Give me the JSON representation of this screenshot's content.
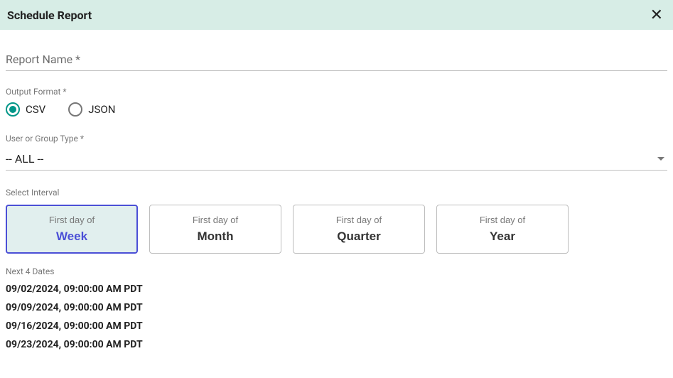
{
  "header": {
    "title": "Schedule Report"
  },
  "reportName": {
    "label": "Report Name *",
    "value": ""
  },
  "outputFormat": {
    "label": "Output Format *",
    "options": [
      {
        "label": "CSV",
        "selected": true
      },
      {
        "label": "JSON",
        "selected": false
      }
    ]
  },
  "userGroup": {
    "label": "User or Group Type *",
    "value": "-- ALL --"
  },
  "interval": {
    "label": "Select Interval",
    "cards": [
      {
        "top": "First day of",
        "bot": "Week",
        "selected": true
      },
      {
        "top": "First day of",
        "bot": "Month",
        "selected": false
      },
      {
        "top": "First day of",
        "bot": "Quarter",
        "selected": false
      },
      {
        "top": "First day of",
        "bot": "Year",
        "selected": false
      }
    ]
  },
  "nextDates": {
    "label": "Next 4 Dates",
    "items": [
      "09/02/2024, 09:00:00 AM PDT",
      "09/09/2024, 09:00:00 AM PDT",
      "09/16/2024, 09:00:00 AM PDT",
      "09/23/2024, 09:00:00 AM PDT"
    ]
  }
}
